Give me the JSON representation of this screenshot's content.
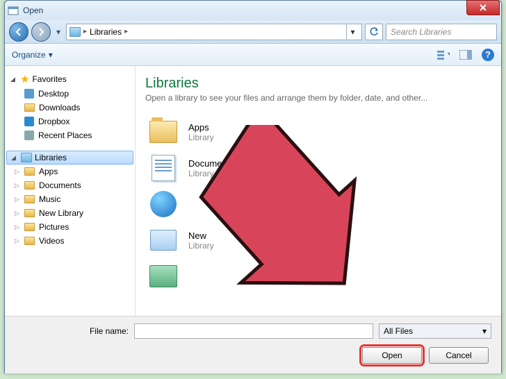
{
  "window": {
    "title": "Open"
  },
  "breadcrumb": {
    "location": "Libraries"
  },
  "search": {
    "placeholder": "Search Libraries"
  },
  "toolbar": {
    "organize": "Organize"
  },
  "sidebar": {
    "favorites_label": "Favorites",
    "favorites": [
      {
        "label": "Desktop"
      },
      {
        "label": "Downloads"
      },
      {
        "label": "Dropbox"
      },
      {
        "label": "Recent Places"
      }
    ],
    "libraries_label": "Libraries",
    "libraries": [
      {
        "label": "Apps"
      },
      {
        "label": "Documents"
      },
      {
        "label": "Music"
      },
      {
        "label": "New Library"
      },
      {
        "label": "Pictures"
      },
      {
        "label": "Videos"
      }
    ]
  },
  "content": {
    "heading": "Libraries",
    "subtext": "Open a library to see your files and arrange them by folder, date, and other...",
    "items": [
      {
        "name": "Apps",
        "type": "Library"
      },
      {
        "name": "Documents",
        "type": "Library"
      },
      {
        "name": "",
        "type": ""
      },
      {
        "name": "New",
        "type": "Library"
      },
      {
        "name": "",
        "type": ""
      }
    ]
  },
  "bottom": {
    "filename_label": "File name:",
    "filename_value": "",
    "filter": "All Files",
    "open": "Open",
    "cancel": "Cancel"
  }
}
